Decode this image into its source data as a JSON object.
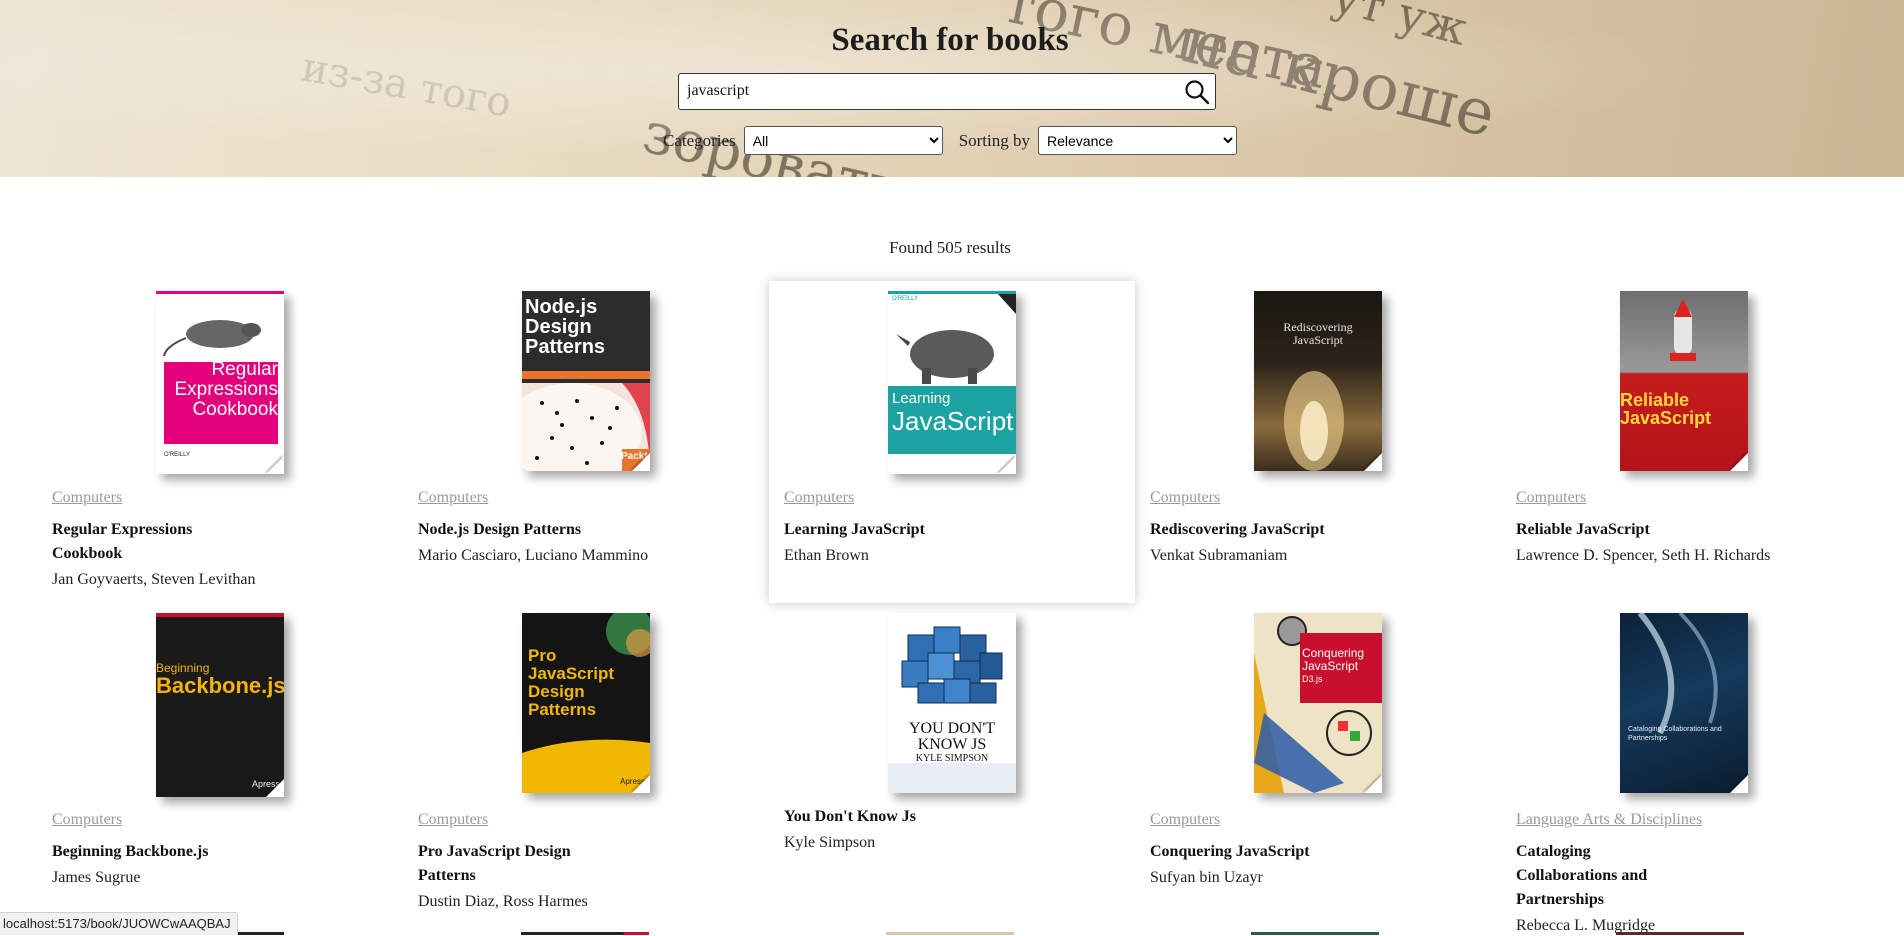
{
  "header": {
    "title": "Search for books",
    "search": {
      "value": "javascript",
      "button_icon": "search-icon"
    },
    "categories_label": "Categories",
    "categories_selected": "All",
    "sorting_label": "Sorting by",
    "sorting_selected": "Relevance"
  },
  "results": {
    "summary": "Found 505 results",
    "books": [
      {
        "category": "Computers",
        "title": "Regular Expressions Cookbook",
        "authors": "Jan Goyvaerts, Steven Levithan",
        "cover_text": [
          "Regular",
          "Expressions",
          "Cookbook"
        ],
        "cover_brand": "O'REILLY"
      },
      {
        "category": "Computers",
        "title": "Node.js Design Patterns",
        "authors": "Mario Casciaro, Luciano Mammino",
        "cover_text": [
          "Node.js",
          "Design",
          "Patterns"
        ],
        "cover_brand": "Packt"
      },
      {
        "category": "Computers",
        "title": "Learning JavaScript",
        "authors": "Ethan Brown",
        "cover_text": [
          "Learning",
          "JavaScript"
        ],
        "cover_brand": "O'REILLY"
      },
      {
        "category": "Computers",
        "title": "Rediscovering JavaScript",
        "authors": "Venkat Subramaniam",
        "cover_text": [
          "Rediscovering",
          "JavaScript"
        ],
        "cover_brand": ""
      },
      {
        "category": "Computers",
        "title": "Reliable JavaScript",
        "authors": "Lawrence D. Spencer, Seth H. Richards",
        "cover_text": [
          "Reliable",
          "JavaScript"
        ],
        "cover_brand": ""
      },
      {
        "category": "Computers",
        "title": "Beginning Backbone.js",
        "authors": "James Sugrue",
        "cover_text": [
          "Beginning",
          "Backbone.js"
        ],
        "cover_brand": "Apress"
      },
      {
        "category": "Computers",
        "title": "Pro JavaScript Design Patterns",
        "authors": "Dustin Diaz, Ross Harmes",
        "cover_text": [
          "Pro",
          "JavaScript",
          "Design Patterns"
        ],
        "cover_brand": "Apress"
      },
      {
        "category": "",
        "title": "You Don't Know Js",
        "authors": "Kyle Simpson",
        "cover_text": [
          "YOU DON'T",
          "KNOW JS",
          "KYLE SIMPSON"
        ],
        "cover_brand": ""
      },
      {
        "category": "Computers",
        "title": "Conquering JavaScript",
        "authors": "Sufyan bin Uzayr",
        "cover_text": [
          "Conquering",
          "JavaScript",
          "D3.js"
        ],
        "cover_brand": ""
      },
      {
        "category": "Language Arts & Disciplines",
        "title": "Cataloging Collaborations and Partnerships",
        "authors": "Rebecca L. Mugridge",
        "cover_text": [
          "Cataloging Collaborations and",
          "Partnerships"
        ],
        "cover_brand": ""
      }
    ]
  },
  "status_bar": {
    "url": "localhost:5173/book/JUOWCwAAQBAJ"
  }
}
